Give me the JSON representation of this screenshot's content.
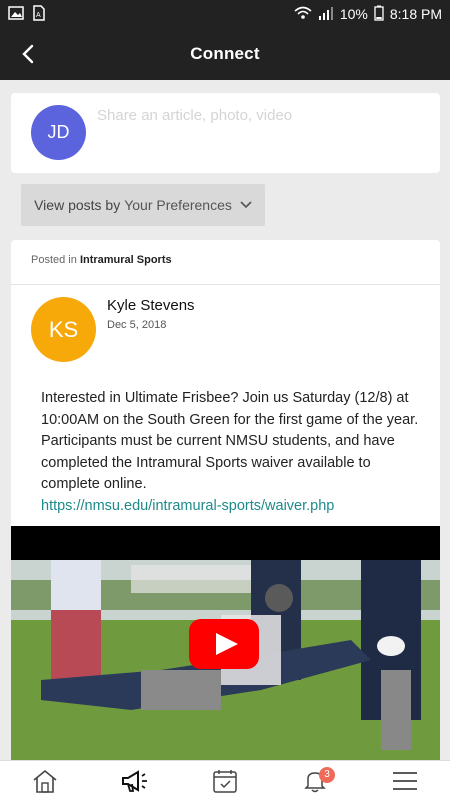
{
  "status_bar": {
    "battery": "10%",
    "time": "8:18 PM"
  },
  "app_bar": {
    "title": "Connect"
  },
  "composer": {
    "avatar_initials": "JD",
    "placeholder": "Share an article, photo, video"
  },
  "filter": {
    "prefix": "View posts by",
    "value": "Your Preferences"
  },
  "post": {
    "posted_in_label": "Posted in",
    "category": "Intramural Sports",
    "author_initials": "KS",
    "author": "Kyle Stevens",
    "date": "Dec 5, 2018",
    "body": "Interested in Ultimate Frisbee? Join us Saturday (12/8) at 10:00AM on the South Green for the first game of the year. Participants must be current NMSU students, and have completed the Intramural Sports waiver available to complete online.",
    "link": "https://nmsu.edu/intramural-sports/waiver.php"
  },
  "bottom_nav": {
    "notifications_count": "3",
    "items": [
      "home",
      "announcements",
      "calendar",
      "notifications",
      "menu"
    ]
  },
  "colors": {
    "header": "#222222",
    "avatar_jd": "#5b63dd",
    "avatar_ks": "#f7a90a",
    "link": "#1e8a8a",
    "badge": "#f06a5a",
    "play": "#ff0000"
  }
}
